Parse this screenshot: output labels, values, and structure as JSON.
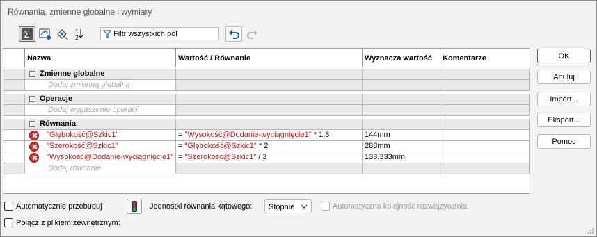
{
  "window": {
    "title": "Równania, zmienne globalne i wymiary"
  },
  "toolbar": {
    "buttons": [
      {
        "icon": "equation-view-icon",
        "active": true
      },
      {
        "icon": "sketch-equation-view-icon",
        "active": false
      },
      {
        "icon": "dimension-view-icon",
        "active": false
      },
      {
        "icon": "ordered-view-icon",
        "active": false
      }
    ],
    "filter_label": "Filtr wszystkich pól",
    "undo_icon": "undo-icon",
    "redo_icon": "redo-icon"
  },
  "table": {
    "columns": [
      "Nazwa",
      "Wartość / Równanie",
      "Wyznacza wartość",
      "Komentarze"
    ],
    "sections": [
      {
        "label": "Zmienne globalne",
        "add_placeholder": "Dodaj zmienną globalną",
        "rows": []
      },
      {
        "label": "Operacje",
        "add_placeholder": "Dodaj wygaszenie operacji",
        "rows": []
      },
      {
        "label": "Równania",
        "add_placeholder": "Dodaj równanie",
        "rows": [
          {
            "name": "\"Głębokość@Szkic1\"",
            "value_prefix": "= ",
            "value_ref": "\"Wysokość@Dodanie-wyciągnięcie1\"",
            "value_suffix": " * 1.8",
            "result": "144mm",
            "comment": ""
          },
          {
            "name": "\"Szerokość@Szkic1\"",
            "value_prefix": "= ",
            "value_ref": "\"Głębokość@Szkic1\"",
            "value_suffix": " * 2",
            "result": "288mm",
            "comment": ""
          },
          {
            "name": "\"Wysokość@Dodanie-wyciągnięcie1\"",
            "value_prefix": "= ",
            "value_ref": "\"Szerokość@Szkic1\"",
            "value_suffix": " / 3",
            "result": "133.333mm",
            "comment": ""
          }
        ]
      }
    ]
  },
  "buttons": {
    "ok": "OK",
    "cancel": "Anuluj",
    "import": "Import...",
    "export": "Eksport...",
    "help": "Pomoc"
  },
  "bottom": {
    "auto_rebuild": "Automatycznie przebuduj",
    "link_file": "Połącz z plikiem zewnętrznym:",
    "angular_units_label": "Jednostki równania kątowego:",
    "angular_units_value": "Stopnie",
    "auto_order": "Automatyczna kolejność rozwiązywania"
  },
  "colors": {
    "error_text": "#c8201e",
    "placeholder_text": "#a8a8a8"
  }
}
